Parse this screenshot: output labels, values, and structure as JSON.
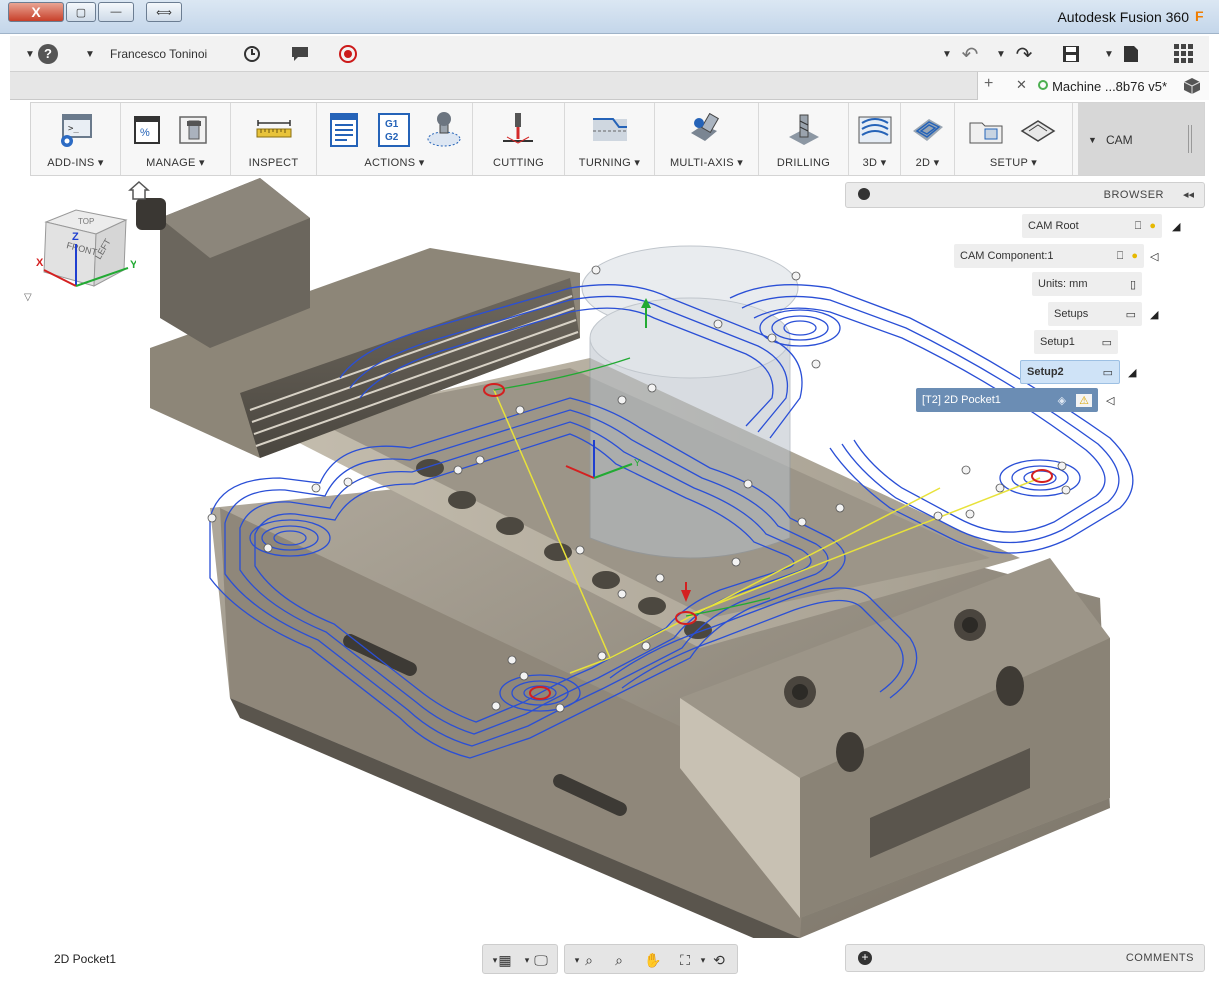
{
  "window": {
    "title": "Autodesk Fusion 360",
    "close_glyph": "X",
    "maximize_glyph": "▢",
    "minimize_glyph": "—",
    "restore_glyph": "⟺"
  },
  "app_toolbar": {
    "help_glyph": "?",
    "user_name": "Francesco Toninoi",
    "user_dropdown_glyph": "▼",
    "grid_glyph": "▦",
    "save_glyph": "💾",
    "undo_glyph": "↶",
    "redo_glyph": "↷",
    "file_glyph": "▾"
  },
  "tabs": {
    "document_name": "Machine ...8b76 v5*",
    "new_tab_glyph": "+",
    "close_tab_glyph": "✕"
  },
  "ribbon": {
    "workspace": "CAM",
    "groups": [
      {
        "label": "ADD-INS ▾"
      },
      {
        "label": "MANAGE ▾"
      },
      {
        "label": "INSPECT"
      },
      {
        "label": "ACTIONS ▾"
      },
      {
        "label": "CUTTING"
      },
      {
        "label": "TURNING ▾"
      },
      {
        "label": "MULTI-AXIS ▾"
      },
      {
        "label": "DRILLING"
      },
      {
        "label": "3D ▾"
      },
      {
        "label": "2D ▾"
      },
      {
        "label": "SETUP ▾"
      }
    ],
    "actions_icon_text_top": "G1",
    "actions_icon_text_bottom": "G2",
    "manage_icon_text": "%"
  },
  "browser": {
    "title": "BROWSER",
    "nodes": [
      {
        "label": "CAM Root"
      },
      {
        "label": "CAM Component:1"
      },
      {
        "label": "Units: mm"
      },
      {
        "label": "Setups"
      },
      {
        "label": "Setup1"
      },
      {
        "label": "Setup2"
      },
      {
        "label": "[T2] 2D Pocket1"
      }
    ]
  },
  "viewcube": {
    "face_front": "FRONT",
    "face_right": "LEFT",
    "face_top": "TOP",
    "axis_x": "X",
    "axis_y": "Y",
    "axis_z": "Z"
  },
  "status": {
    "operation": "2D Pocket1"
  },
  "comments": {
    "title": "COMMENTS"
  },
  "colors": {
    "toolpath": "#2a4fd6",
    "rapid": "#e8e23a",
    "lead": "#22aa33",
    "model": "#8f877a",
    "accent": "#2563b8"
  }
}
